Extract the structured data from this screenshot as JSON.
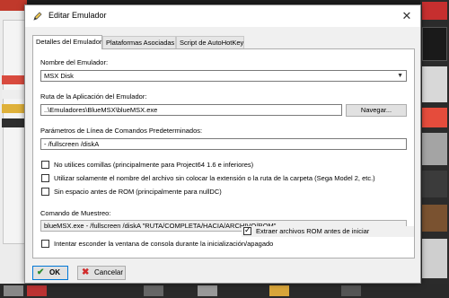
{
  "window": {
    "title": "Editar Emulador",
    "close_glyph": "✕"
  },
  "tabs": [
    {
      "label": "Detalles del Emulador",
      "active": true
    },
    {
      "label": "Plataformas Asociadas",
      "active": false
    },
    {
      "label": "Script de AutoHotKey",
      "active": false
    }
  ],
  "form": {
    "name_label": "Nombre del Emulador:",
    "name_value": "MSX Disk",
    "path_label": "Ruta de la Aplicación del Emulador:",
    "path_value": "..\\Emuladores\\BlueMSX\\blueMSX.exe",
    "browse_label": "Navegar...",
    "params_label": "Parámetros de Línea de Comandos Predeterminados:",
    "params_value": "- /fullscreen /diskA",
    "options": [
      {
        "label": "No utilices comillas (principalmente para Project64 1.6 e inferiores)",
        "checked": false
      },
      {
        "label": "Utilizar solamente el nombre del archivo sin colocar la extensión o la ruta de la carpeta  (Sega Model 2, etc.)",
        "checked": false
      },
      {
        "label": "Sin espacio antes de ROM (principalmente para nullDC)",
        "checked": false
      }
    ],
    "sample_label": "Comando de Muestreo:",
    "sample_value": "blueMSX.exe - /fullscreen /diskA \"RUTA/COMPLETA/HACIA/ARCHIVO/ROM\"",
    "hide_console_label": "Intentar esconder la ventana de consola durante la inicialización/apagado",
    "hide_console_checked": false,
    "extract_label": "Extraer archivos ROM antes de iniciar",
    "extract_checked": true
  },
  "buttons": {
    "ok_label": "OK",
    "ok_icon": "✔",
    "cancel_label": "Cancelar",
    "cancel_icon": "✖"
  },
  "colors": {
    "ok_icon": "#2e8b2e",
    "cancel_icon": "#d12b2b",
    "focus_border": "#0078d7"
  }
}
